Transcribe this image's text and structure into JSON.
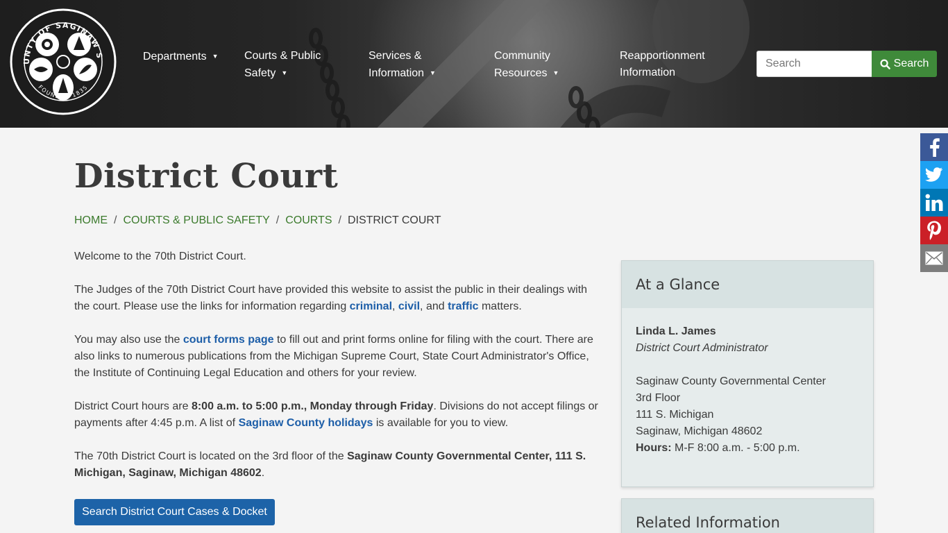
{
  "header": {
    "seal": {
      "top_text": "COUNTY OF SAGINAW SEAL",
      "bottom_text": "FOUNDED 1835"
    },
    "nav": [
      {
        "line1": "Departments",
        "line2": "",
        "dropdown": true
      },
      {
        "line1": "Courts & Public",
        "line2": "Safety",
        "dropdown": true
      },
      {
        "line1": "Services &",
        "line2": "Information",
        "dropdown": true
      },
      {
        "line1": "Community",
        "line2": "Resources",
        "dropdown": true
      },
      {
        "line1": "Reapportionment",
        "line2": "Information",
        "dropdown": false
      }
    ],
    "search": {
      "placeholder": "Search",
      "value": "",
      "button_label": "Search"
    }
  },
  "social": [
    {
      "name": "facebook-icon",
      "color": "#3b5998"
    },
    {
      "name": "twitter-icon",
      "color": "#1da1f2"
    },
    {
      "name": "linkedin-icon",
      "color": "#0077b5"
    },
    {
      "name": "pinterest-icon",
      "color": "#cb2027"
    },
    {
      "name": "email-icon",
      "color": "#7d7d7d"
    }
  ],
  "page": {
    "title": "District Court",
    "breadcrumb": [
      {
        "label": "HOME",
        "link": true
      },
      {
        "label": "COURTS & PUBLIC SAFETY",
        "link": true
      },
      {
        "label": "COURTS",
        "link": true
      },
      {
        "label": "DISTRICT COURT",
        "link": false
      }
    ]
  },
  "content": {
    "p1": "Welcome to the 70th District Court.",
    "p2": {
      "before": "The Judges of the 70th District Court have provided this website to assist the public in their dealings with the court. Please use the links for information regarding ",
      "link1": "criminal",
      "sep1": ", ",
      "link2": "civil",
      "sep2": ", and ",
      "link3": "traffic",
      "after": " matters."
    },
    "p3": {
      "before": "You may also use the ",
      "link": "court forms page",
      "after": " to fill out and print forms online for filing with the court. There are also links to numerous publications from the Michigan Supreme Court, State Court Administrator's Office, the Institute of Continuing Legal Education and others for your review."
    },
    "p4": {
      "before": "District Court hours are ",
      "bold": "8:00 a.m. to 5:00 p.m., Monday through Friday",
      "middle": ". Divisions do not accept filings or payments after 4:45 p.m. A list of ",
      "link": "Saginaw County holidays",
      "after": " is available for you to view."
    },
    "p5": {
      "before": "The 70th District Court is located on the 3rd floor of the ",
      "bold": "Saginaw County Governmental Center, 111 S. Michigan, Saginaw, Michigan 48602",
      "after": "."
    },
    "cases_button": "Search District Court Cases & Docket"
  },
  "glance": {
    "title": "At a Glance",
    "name": "Linda L. James",
    "role": "District Court Administrator",
    "address": [
      "Saginaw County Governmental Center",
      "3rd Floor",
      "111 S. Michigan",
      "Saginaw, Michigan 48602"
    ],
    "hours_label": "Hours:",
    "hours_value": " M-F 8:00 a.m. - 5:00 p.m."
  },
  "related": {
    "title": "Related Information"
  }
}
